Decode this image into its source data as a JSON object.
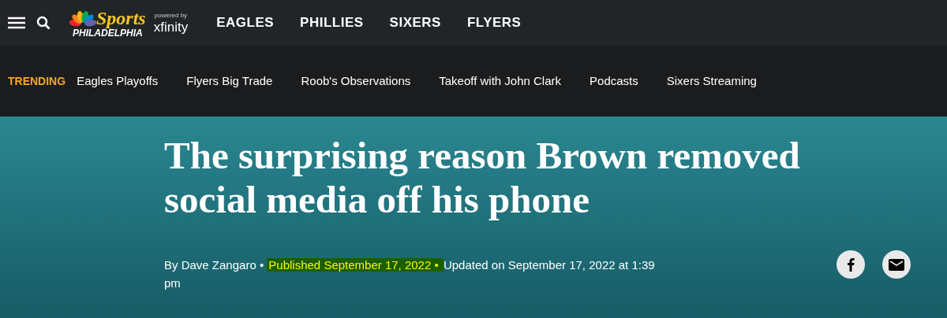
{
  "header": {
    "logo": {
      "word": "Sports",
      "city": "PHILADELPHIA",
      "powered_by": "powered by",
      "partner": "xfinity"
    },
    "nav": [
      {
        "label": "EAGLES"
      },
      {
        "label": "PHILLIES"
      },
      {
        "label": "SIXERS"
      },
      {
        "label": "FLYERS"
      }
    ]
  },
  "trending": {
    "label": "TRENDING",
    "links": [
      {
        "label": "Eagles Playoffs"
      },
      {
        "label": "Flyers Big Trade"
      },
      {
        "label": "Roob's Observations"
      },
      {
        "label": "Takeoff with John Clark"
      },
      {
        "label": "Podcasts"
      },
      {
        "label": "Sixers Streaming"
      }
    ]
  },
  "article": {
    "headline": "The surprising reason Brown removed social media off his phone",
    "byline": [
      {
        "text": "By Dave Zangaro •",
        "highlighted": false
      },
      {
        "text": "Published September 17, 2022 •",
        "highlighted": true
      },
      {
        "text": "Updated on September 17, 2022 at 1:39 pm",
        "highlighted": false
      }
    ],
    "share": [
      {
        "kind": "facebook"
      },
      {
        "kind": "email"
      }
    ]
  }
}
